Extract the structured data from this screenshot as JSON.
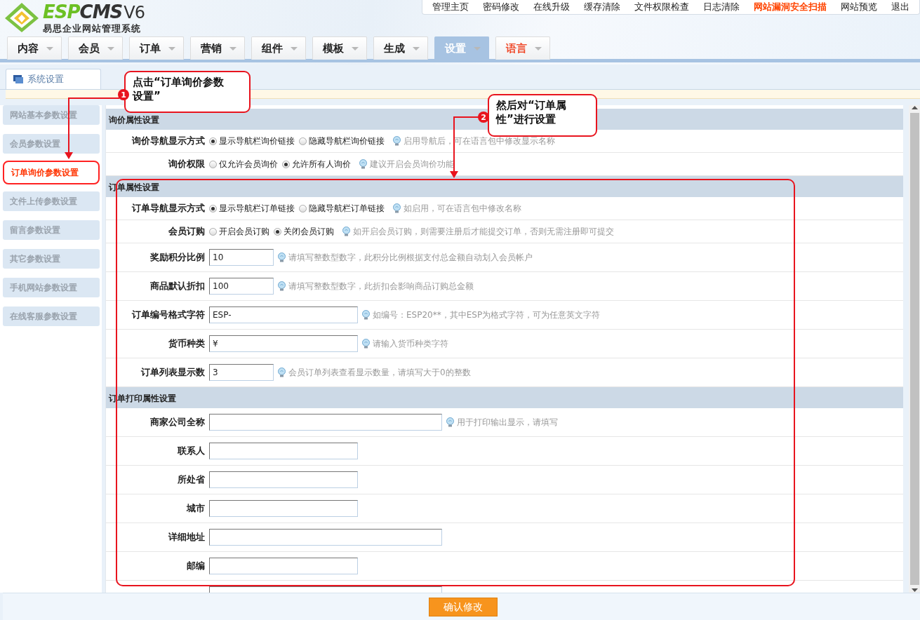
{
  "logo": {
    "brand_a": "ESP",
    "brand_b": "CMS",
    "version": "V6",
    "subtitle": "易思企业网站管理系统"
  },
  "top_links": [
    {
      "label": "管理主页",
      "highlight": false
    },
    {
      "label": "密码修改",
      "highlight": false
    },
    {
      "label": "在线升级",
      "highlight": false
    },
    {
      "label": "缓存清除",
      "highlight": false
    },
    {
      "label": "文件权限检查",
      "highlight": false
    },
    {
      "label": "日志清除",
      "highlight": false
    },
    {
      "label": "网站漏洞安全扫描",
      "highlight": true
    },
    {
      "label": "网站预览",
      "highlight": false
    },
    {
      "label": "退出",
      "highlight": false
    }
  ],
  "nav_tabs": [
    {
      "label": "内容",
      "selected": false,
      "highlight": false
    },
    {
      "label": "会员",
      "selected": false,
      "highlight": false
    },
    {
      "label": "订单",
      "selected": false,
      "highlight": false
    },
    {
      "label": "营销",
      "selected": false,
      "highlight": false
    },
    {
      "label": "组件",
      "selected": false,
      "highlight": false
    },
    {
      "label": "模板",
      "selected": false,
      "highlight": false
    },
    {
      "label": "生成",
      "selected": false,
      "highlight": false
    },
    {
      "label": "设置",
      "selected": true,
      "highlight": false
    },
    {
      "label": "语言",
      "selected": false,
      "highlight": true
    }
  ],
  "page_tab": {
    "label": "系统设置"
  },
  "sidebar": {
    "items": [
      {
        "label": "网站基本参数设置",
        "selected": false
      },
      {
        "label": "会员参数设置",
        "selected": false
      },
      {
        "label": "订单询价参数设置",
        "selected": true
      },
      {
        "label": "文件上传参数设置",
        "selected": false
      },
      {
        "label": "留言参数设置",
        "selected": false
      },
      {
        "label": "其它参数设置",
        "selected": false
      },
      {
        "label": "手机网站参数设置",
        "selected": false
      },
      {
        "label": "在线客服参数设置",
        "selected": false
      }
    ]
  },
  "sections": [
    {
      "title": "询价属性设置",
      "rows": [
        {
          "kind": "radio",
          "label": "询价导航显示方式",
          "options": [
            {
              "label": "显示导航栏询价链接",
              "selected": true
            },
            {
              "label": "隐藏导航栏询价链接",
              "selected": false
            }
          ],
          "hint": "启用导航后，可在语言包中修改显示名称"
        },
        {
          "kind": "radio",
          "label": "询价权限",
          "options": [
            {
              "label": "仅允许会员询价",
              "selected": false
            },
            {
              "label": "允许所有人询价",
              "selected": true
            }
          ],
          "hint": "建议开启会员询价功能"
        }
      ]
    },
    {
      "title": "订单属性设置",
      "rows": [
        {
          "kind": "radio",
          "label": "订单导航显示方式",
          "options": [
            {
              "label": "显示导航栏订单链接",
              "selected": true
            },
            {
              "label": "隐藏导航栏订单链接",
              "selected": false
            }
          ],
          "hint": "如启用，可在语言包中修改名称"
        },
        {
          "kind": "radio",
          "label": "会员订购",
          "options": [
            {
              "label": "开启会员订购",
              "selected": false
            },
            {
              "label": "关闭会员订购",
              "selected": true
            }
          ],
          "hint": "如开启会员订购，则需要注册后才能提交订单，否则无需注册即可提交"
        },
        {
          "kind": "short_input",
          "label": "奖励积分比例",
          "value": "10",
          "hint": "请填写整数型数字，此积分比例根据支付总金额自动划入会员帐户"
        },
        {
          "kind": "short_input",
          "label": "商品默认折扣",
          "value": "100",
          "hint": "请填写整数型数字，此折扣会影响商品订购总金额"
        },
        {
          "kind": "input",
          "label": "订单编号格式字符",
          "value": "ESP-",
          "hint": "如编号：ESP20**，其中ESP为格式字符，可为任意英文字符"
        },
        {
          "kind": "input",
          "label": "货币种类",
          "value": "¥",
          "hint": "请输入货币种类字符"
        },
        {
          "kind": "short_input",
          "label": "订单列表显示数",
          "value": "3",
          "hint": "会员订单列表查看显示数量，请填写大于0的整数"
        }
      ]
    },
    {
      "title": "订单打印属性设置",
      "rows": [
        {
          "kind": "long_input",
          "label": "商家公司全称",
          "hint": "用于打印输出显示，请填写"
        },
        {
          "kind": "input",
          "label": "联系人"
        },
        {
          "kind": "input",
          "label": "所处省"
        },
        {
          "kind": "input",
          "label": "城市"
        },
        {
          "kind": "long_input",
          "label": "详细地址"
        },
        {
          "kind": "input",
          "label": "邮编"
        },
        {
          "kind": "long_input"
        }
      ]
    }
  ],
  "submit": {
    "label": "确认修改"
  },
  "callouts": [
    {
      "number": "1",
      "text": "点击“订单询价参数设置”"
    },
    {
      "number": "2",
      "text": "然后对“订单属性”进行设置"
    }
  ]
}
